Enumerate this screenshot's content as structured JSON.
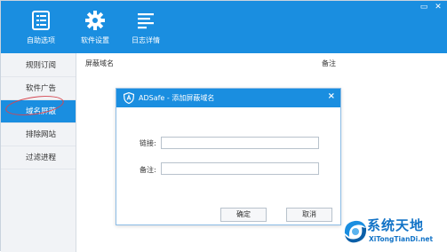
{
  "window": {
    "min_glyph": "▭",
    "close_glyph": "✕"
  },
  "toolbar": {
    "items": [
      {
        "label": "自助选项",
        "icon": "list-icon"
      },
      {
        "label": "软件设置",
        "icon": "gear-icon"
      },
      {
        "label": "日志详情",
        "icon": "log-icon"
      }
    ]
  },
  "sidebar": {
    "items": [
      {
        "label": "规则订阅"
      },
      {
        "label": "软件广告"
      },
      {
        "label": "域名屏蔽"
      },
      {
        "label": "排除网站"
      },
      {
        "label": "过滤进程"
      }
    ],
    "active_index": 2
  },
  "table": {
    "columns": [
      "屏蔽域名",
      "备注"
    ]
  },
  "dialog": {
    "title": "ADSafe - 添加屏蔽域名",
    "close_glyph": "×",
    "fields": [
      {
        "label": "链接:",
        "value": "",
        "placeholder": ""
      },
      {
        "label": "备注:",
        "value": "",
        "placeholder": ""
      }
    ],
    "ok_label": "确定",
    "cancel_label": "取消"
  },
  "watermark": {
    "cn": "系统天地",
    "en": "XiTongTianDi.net"
  },
  "colors": {
    "accent": "#1a8ee0",
    "highlight_oval": "#d64550",
    "watermark": "#1273c7"
  }
}
